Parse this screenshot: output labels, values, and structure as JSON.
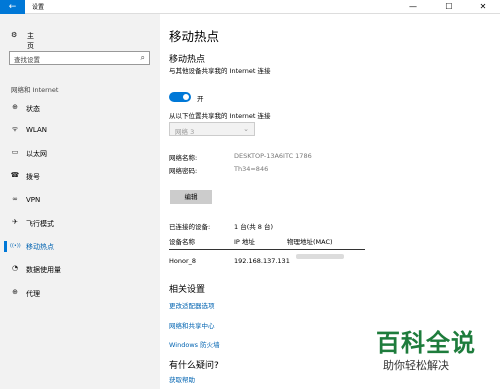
{
  "window": {
    "back_icon": "←",
    "title": "设置",
    "min_icon": "—",
    "max_icon": "☐",
    "close_icon": "✕"
  },
  "sidebar": {
    "home_icon": "⚙",
    "home_label": "主页",
    "search_placeholder": "查找设置",
    "search_icon": "⌕",
    "section_label": "网络和 Internet",
    "items": [
      {
        "icon": "⊕",
        "label": "状态"
      },
      {
        "icon": "ᯤ",
        "label": "WLAN"
      },
      {
        "icon": "▭",
        "label": "以太网"
      },
      {
        "icon": "☎",
        "label": "拨号"
      },
      {
        "icon": "∞",
        "label": "VPN"
      },
      {
        "icon": "✈",
        "label": "飞行模式"
      },
      {
        "icon": "((•))",
        "label": "移动热点"
      },
      {
        "icon": "◔",
        "label": "数据使用量"
      },
      {
        "icon": "⊕",
        "label": "代理"
      }
    ]
  },
  "main": {
    "page_title": "移动热点",
    "hotspot": {
      "heading": "移动热点",
      "description": "与其他设备共享我的 Internet 连接",
      "toggle_state": "开"
    },
    "share_from": {
      "label": "从以下位置共享我的 Internet 连接",
      "selected": "网络 3",
      "chevron": "⌄"
    },
    "network_name_label": "网络名称:",
    "network_name_value": "DESKTOP-13A6ITC 1786",
    "network_password_label": "网络密码:",
    "network_password_value": "Th34=846",
    "edit_button": "编辑",
    "connected_label": "已连接的设备:",
    "connected_value": "1 台(共 8 台)",
    "table": {
      "headers": [
        "设备名称",
        "IP 地址",
        "物理地址(MAC)"
      ],
      "rows": [
        {
          "device": "Honor_8",
          "ip": "192.168.137.131"
        }
      ]
    },
    "related": {
      "heading": "相关设置",
      "links": [
        "更改适配器选项",
        "网络和共享中心",
        "Windows 防火墙"
      ]
    },
    "questions": {
      "heading": "有什么疑问?",
      "link": "获取帮助"
    }
  },
  "watermark": {
    "big": "百科全说",
    "small": "助你轻松解决"
  }
}
